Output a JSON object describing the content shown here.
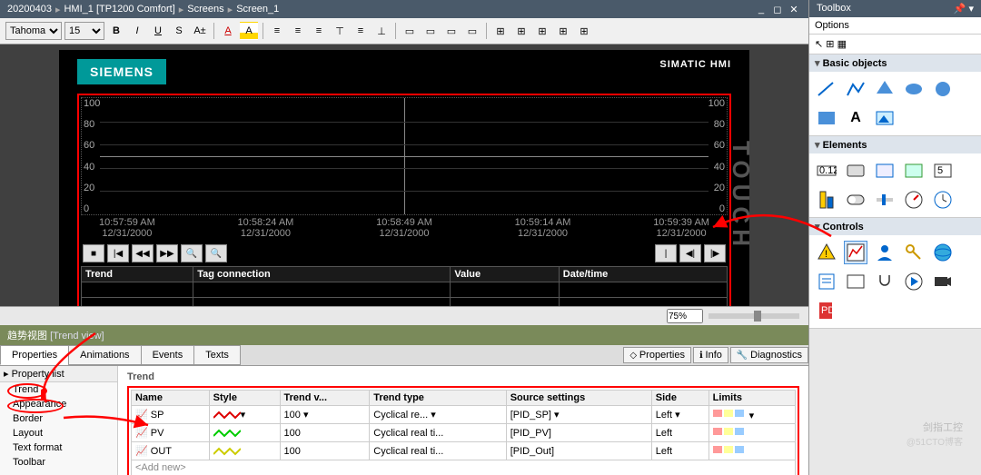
{
  "breadcrumb": [
    "20200403",
    "HMI_1 [TP1200 Comfort]",
    "Screens",
    "Screen_1"
  ],
  "font": {
    "family": "Tahoma",
    "size": "15"
  },
  "fmt_buttons": [
    "B",
    "I",
    "U",
    "S",
    "A±",
    "A",
    "A",
    "≡",
    "≡",
    "≡",
    "≡",
    "—",
    "▭",
    "▭",
    "▯",
    "▯",
    "⊞",
    "⊞",
    "⊞"
  ],
  "hmi": {
    "brand": "SIEMENS",
    "product": "SIMATIC HMI",
    "touch": "TOUCH"
  },
  "chart_data": {
    "type": "line",
    "series": [
      {
        "name": "SP",
        "values": []
      },
      {
        "name": "PV",
        "values": []
      },
      {
        "name": "OUT",
        "values": []
      }
    ],
    "ylim_left": [
      0,
      100
    ],
    "yticks_left": [
      100,
      80,
      60,
      40,
      20,
      0
    ],
    "ylim_right": [
      0,
      100
    ],
    "yticks_right": [
      100,
      80,
      60,
      40,
      20,
      0
    ],
    "xticks": [
      {
        "t": "10:57:59 AM",
        "d": "12/31/2000"
      },
      {
        "t": "10:58:24 AM",
        "d": "12/31/2000"
      },
      {
        "t": "10:58:49 AM",
        "d": "12/31/2000"
      },
      {
        "t": "10:59:14 AM",
        "d": "12/31/2000"
      },
      {
        "t": "10:59:39 AM",
        "d": "12/31/2000"
      }
    ],
    "toolbar": [
      "■",
      "|◀",
      "◀◀",
      "▶▶",
      "🔍",
      "🔍",
      " ",
      " ",
      "|",
      "◀|",
      "|▶"
    ],
    "table_headers": [
      "Trend",
      "Tag connection",
      "Value",
      "Date/time"
    ]
  },
  "zoom": "75%",
  "prop": {
    "title_cn": "趋势视图",
    "title_en": "[Trend view]",
    "tabs": [
      "Properties",
      "Animations",
      "Events",
      "Texts"
    ],
    "right_tabs": [
      "Properties",
      "Info",
      "Diagnostics"
    ],
    "nav_hdr": "Property list",
    "nav": [
      "Trend",
      "Appearance",
      "Border",
      "Layout",
      "Text format",
      "Toolbar"
    ],
    "section": "Trend",
    "tbl_headers": [
      "Name",
      "Style",
      "Trend v...",
      "Trend type",
      "Source settings",
      "Side",
      "Limits"
    ],
    "rows": [
      {
        "name": "SP",
        "style_color": "#d00",
        "tv": "100",
        "tt": "Cyclical re...",
        "src": "[PID_SP]",
        "side": "Left"
      },
      {
        "name": "PV",
        "style_color": "#0c0",
        "tv": "100",
        "tt": "Cyclical real ti...",
        "src": "[PID_PV]",
        "side": "Left"
      },
      {
        "name": "OUT",
        "style_color": "#cc0",
        "tv": "100",
        "tt": "Cyclical real ti...",
        "src": "[PID_Out]",
        "side": "Left"
      }
    ],
    "addnew": "<Add new>"
  },
  "toolbox": {
    "title": "Toolbox",
    "options": "Options",
    "sections": {
      "basic": {
        "label": "Basic objects",
        "items": [
          "line",
          "polyline",
          "polygon",
          "ellipse",
          "circle",
          "rect",
          "text",
          "image"
        ]
      },
      "elements": {
        "label": "Elements",
        "items": [
          "iofield",
          "button",
          "symbol",
          "graphic",
          "datefield",
          "bar",
          "switch",
          "slider",
          "gauge",
          "clock"
        ]
      },
      "controls": {
        "label": "Controls",
        "items": [
          "alarm",
          "trend",
          "user",
          "system",
          "html",
          "recipe",
          "media",
          "script",
          "sm",
          "camera",
          "pdf"
        ]
      }
    }
  },
  "watermark": {
    "main": "剑指工控",
    "sub": "@51CTO博客"
  }
}
